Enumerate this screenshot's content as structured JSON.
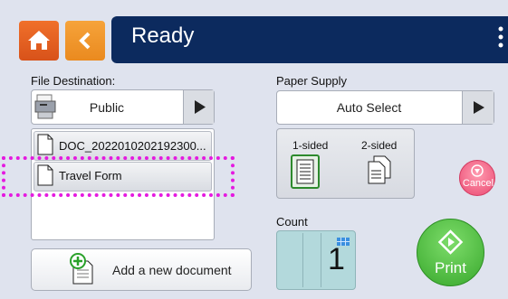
{
  "header": {
    "title": "Ready"
  },
  "left_panel": {
    "file_destination_label": "File Destination:",
    "destination_value": "Public",
    "files": [
      {
        "name": "DOC_2022010202192300..."
      },
      {
        "name": "Travel Form"
      }
    ],
    "add_document_label": "Add a new document"
  },
  "right_panel": {
    "paper_supply_label": "Paper Supply",
    "paper_supply_value": "Auto Select",
    "one_sided_label": "1-sided",
    "two_sided_label": "2-sided",
    "cancel_label": "Cancel",
    "count_label": "Count",
    "count_value": "1",
    "print_label": "Print"
  },
  "colors": {
    "title_bar": "#0c2a5e",
    "home_button": "#e8602a",
    "back_button": "#f29a30",
    "highlight": "#e51ae0",
    "print_button": "#4cb63a",
    "cancel_button": "#ea4a72"
  }
}
